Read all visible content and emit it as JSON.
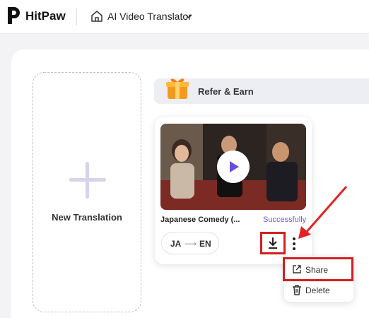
{
  "header": {
    "brand": "HitPaw",
    "app_title": "AI Video Translator"
  },
  "new_translation": {
    "label": "New Translation"
  },
  "refer": {
    "label": "Refer & Earn"
  },
  "video": {
    "title": "Japanese Comedy (...",
    "status": "Successfully",
    "source_lang": "JA",
    "arrow": "⟶",
    "target_lang": "EN"
  },
  "menu": {
    "items": [
      {
        "label": "Share",
        "icon": "share-icon"
      },
      {
        "label": "Delete",
        "icon": "trash-icon"
      }
    ]
  },
  "colors": {
    "accent": "#6a4ce0",
    "highlight": "#d11f1f"
  }
}
